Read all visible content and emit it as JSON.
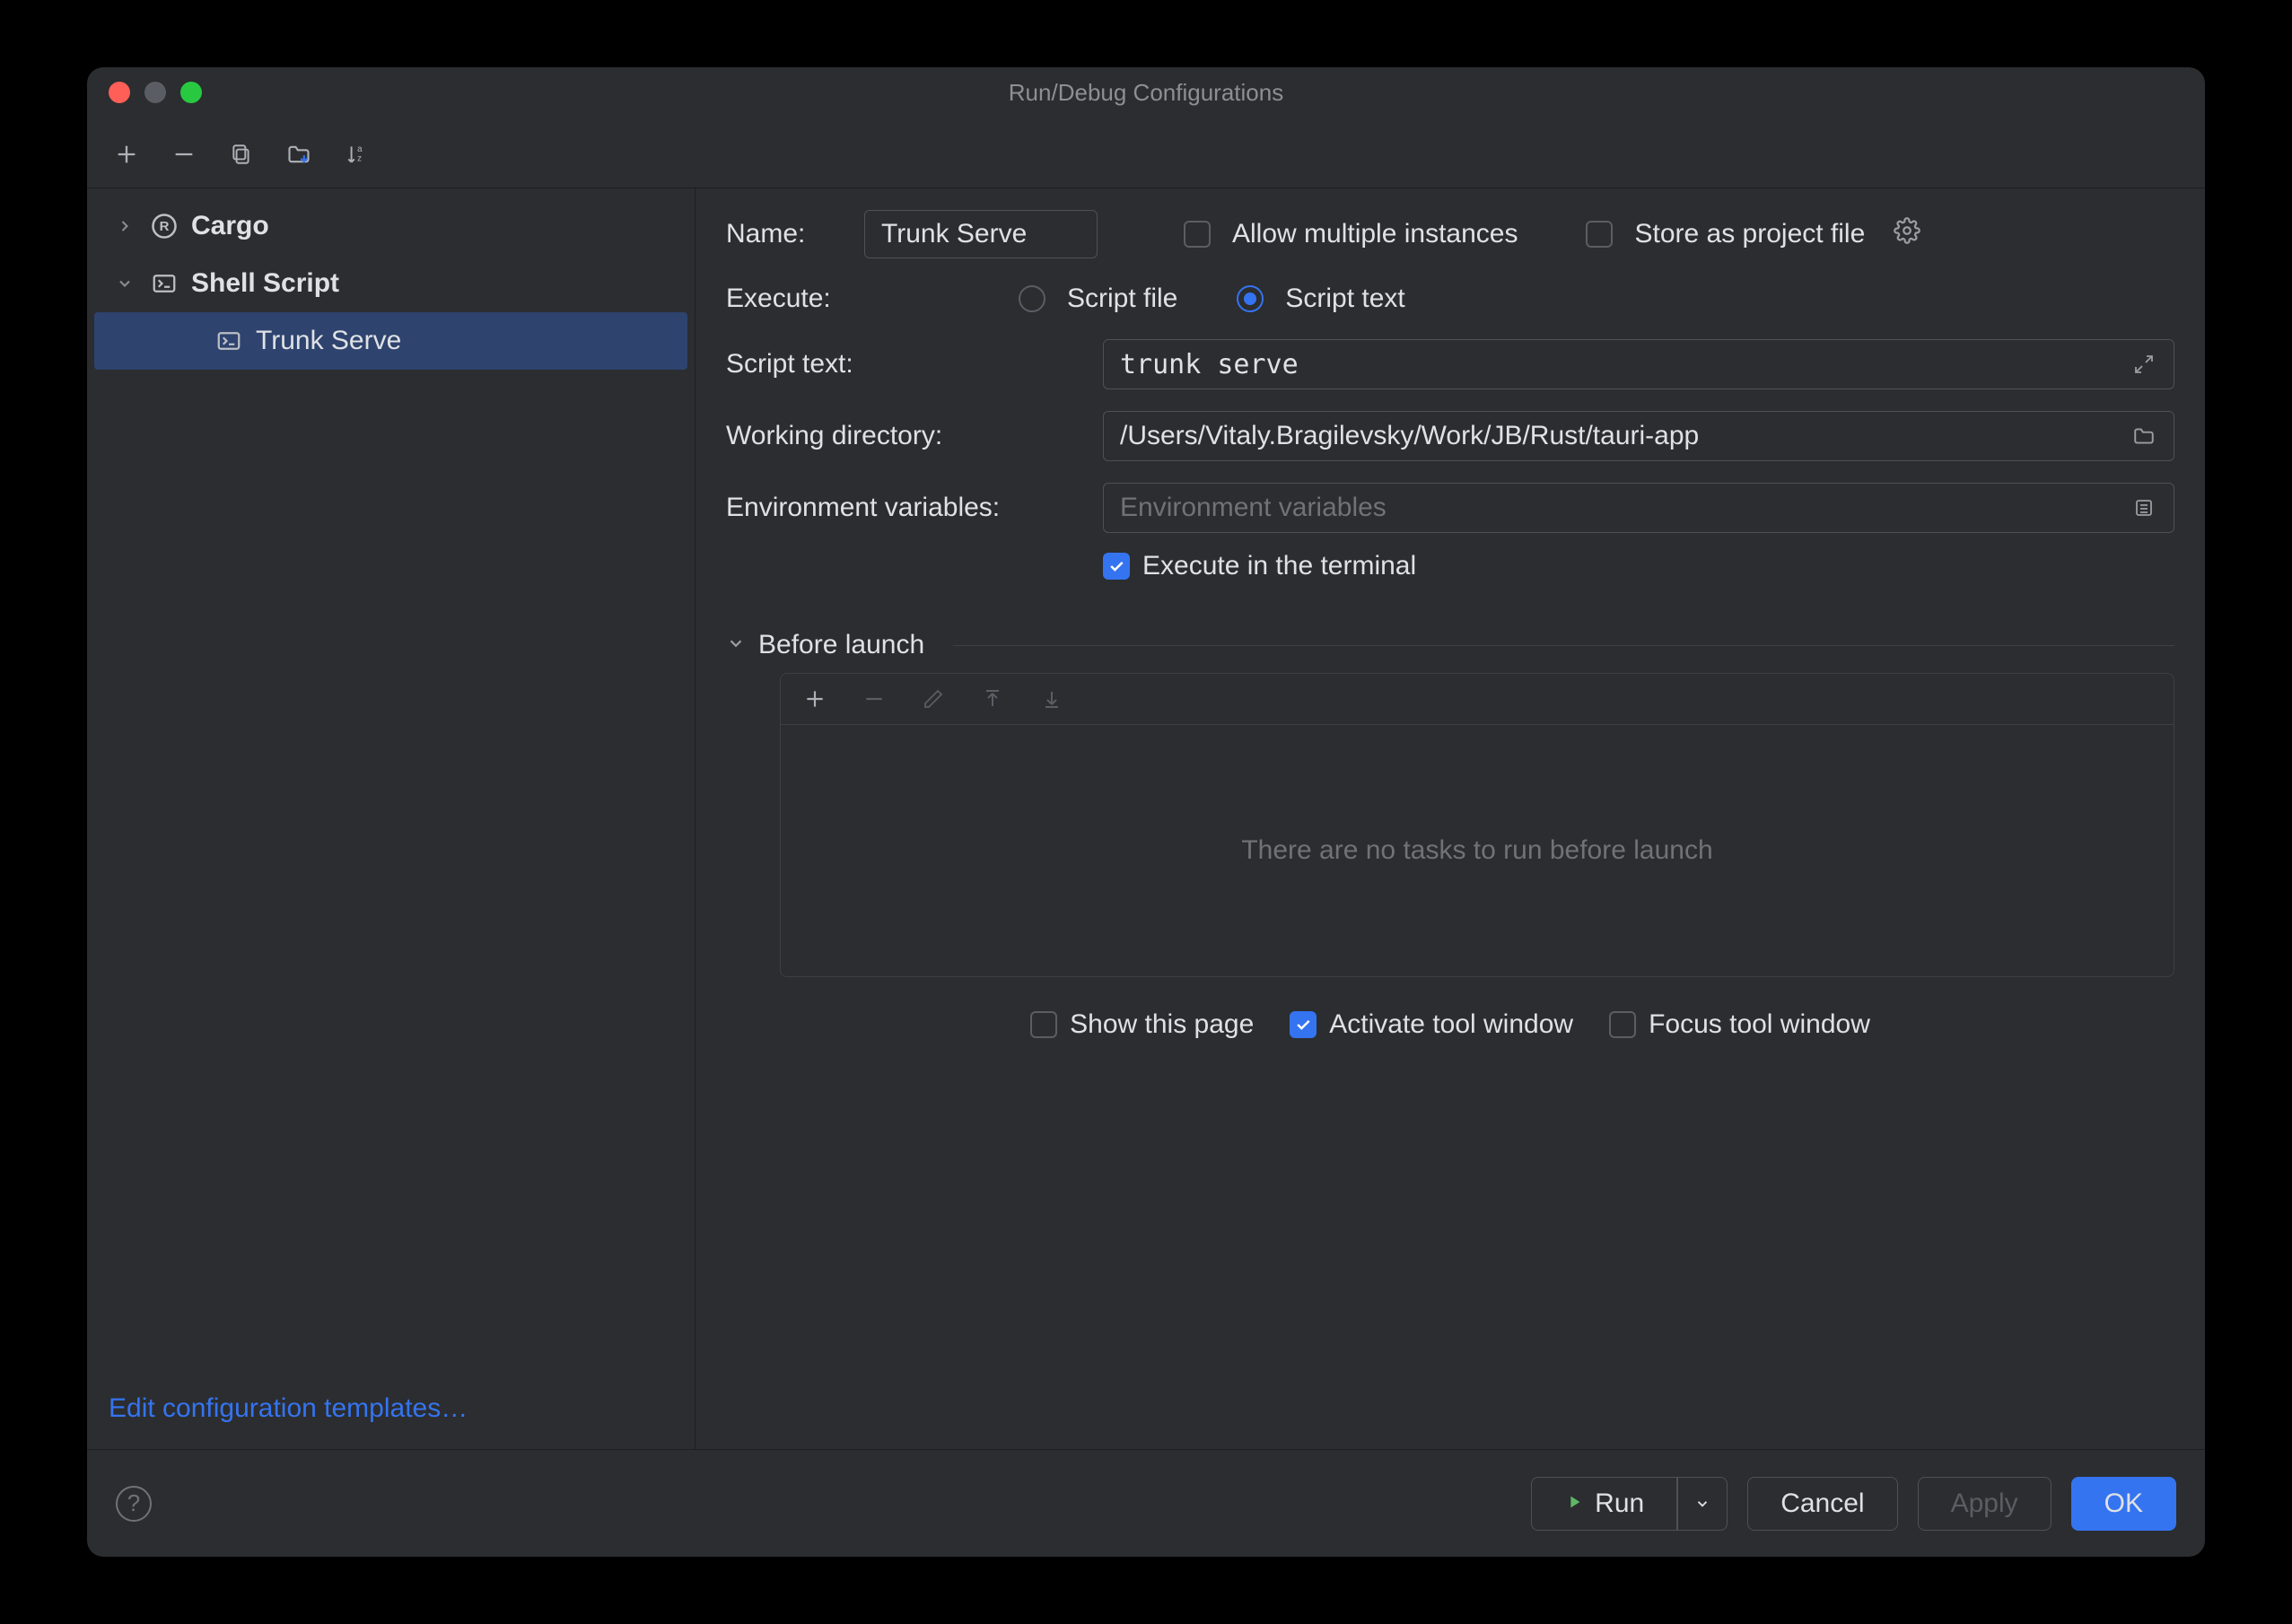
{
  "window": {
    "title": "Run/Debug Configurations"
  },
  "sidebar": {
    "items": [
      {
        "label": "Cargo",
        "expanded": false
      },
      {
        "label": "Shell Script",
        "expanded": true,
        "children": [
          {
            "label": "Trunk Serve",
            "selected": true
          }
        ]
      }
    ],
    "edit_templates": "Edit configuration templates…"
  },
  "form": {
    "name_label": "Name:",
    "name_value": "Trunk Serve",
    "allow_multiple": {
      "label": "Allow multiple instances",
      "checked": false
    },
    "store_project": {
      "label": "Store as project file",
      "checked": false
    },
    "execute_label": "Execute:",
    "radio_script_file": "Script file",
    "radio_script_text": "Script text",
    "execute_mode": "text",
    "script_text_label": "Script text:",
    "script_text_value": "trunk serve",
    "working_dir_label": "Working directory:",
    "working_dir_value": "/Users/Vitaly.Bragilevsky/Work/JB/Rust/tauri-app",
    "env_label": "Environment variables:",
    "env_placeholder": "Environment variables",
    "execute_terminal": {
      "label": "Execute in the terminal",
      "checked": true
    },
    "before_launch_title": "Before launch",
    "before_launch_empty": "There are no tasks to run before launch",
    "show_page": {
      "label": "Show this page",
      "checked": false
    },
    "activate_tw": {
      "label": "Activate tool window",
      "checked": true
    },
    "focus_tw": {
      "label": "Focus tool window",
      "checked": false
    }
  },
  "footer": {
    "run": "Run",
    "cancel": "Cancel",
    "apply": "Apply",
    "ok": "OK"
  }
}
